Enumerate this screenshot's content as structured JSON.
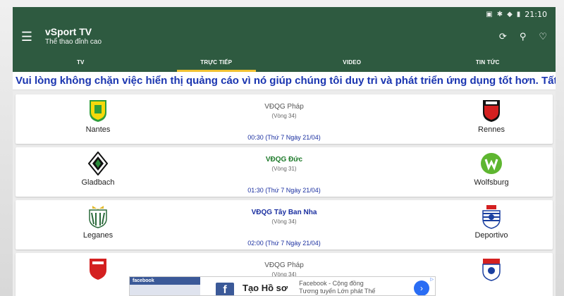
{
  "status_bar": {
    "time": "21:10"
  },
  "app": {
    "title": "vSport TV",
    "subtitle": "Thể thao đỉnh cao"
  },
  "tabs": [
    {
      "label": "TV",
      "active": false
    },
    {
      "label": "TRỰC TIẾP",
      "active": true
    },
    {
      "label": "VIDEO",
      "active": false
    },
    {
      "label": "TIN TỨC",
      "active": false
    }
  ],
  "notice": "Vui lòng không chặn việc hiển thị quảng cáo vì nó giúp chúng tôi duy trì và phát triển ứng dụng tốt hơn. Tất cả thiết bị cả",
  "matches": [
    {
      "home": "Nantes",
      "away": "Rennes",
      "league": "VĐQG Pháp",
      "round": "(Vòng 34)",
      "time": "00:30 (Thứ 7 Ngày 21/04)"
    },
    {
      "home": "Gladbach",
      "away": "Wolfsburg",
      "league": "VĐQG Đức",
      "round": "(Vòng 31)",
      "time": "01:30 (Thứ 7 Ngày 21/04)"
    },
    {
      "home": "Leganes",
      "away": "Deportivo",
      "league": "VĐQG Tây Ban Nha",
      "round": "(Vòng 34)",
      "time": "02:00 (Thứ 7 Ngày 21/04)"
    },
    {
      "home": "",
      "away": "",
      "league": "VĐQG Pháp",
      "round": "(Vòng 34)",
      "time": ""
    }
  ],
  "ad": {
    "thumb_label": "facebook",
    "title": "Tạo Hồ sơ",
    "desc_line1": "Facebook - Cộng đồng",
    "desc_line2": "Tương tuyến Lớn phát Thế"
  },
  "colors": {
    "primary": "#2e5a40",
    "accent": "#f1c232",
    "link": "#1a2fa0"
  }
}
